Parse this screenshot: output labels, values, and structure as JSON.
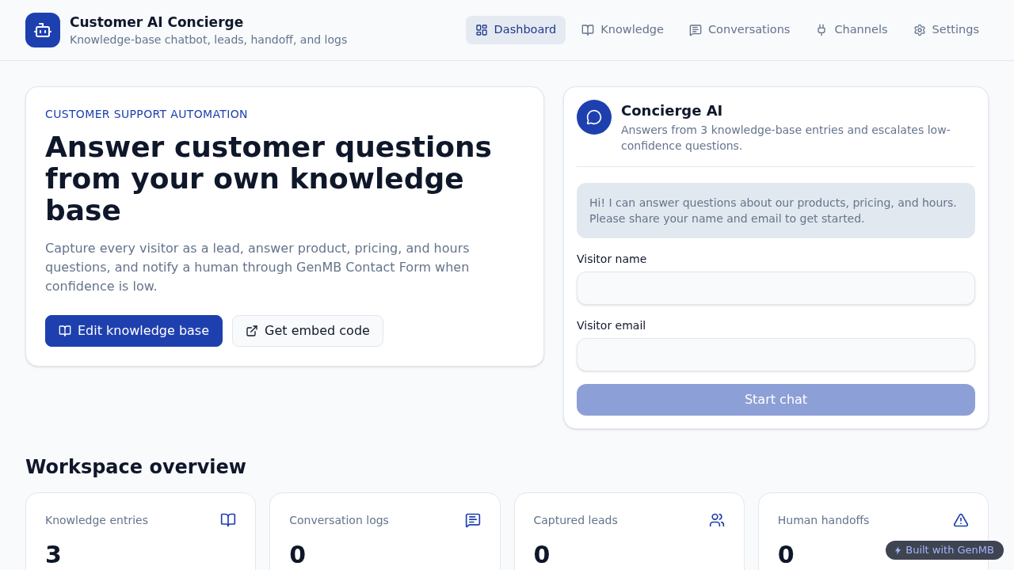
{
  "header": {
    "title": "Customer AI Concierge",
    "subtitle": "Knowledge-base chatbot, leads, handoff, and logs"
  },
  "nav": [
    {
      "label": "Dashboard",
      "selected": true
    },
    {
      "label": "Knowledge",
      "selected": false
    },
    {
      "label": "Conversations",
      "selected": false
    },
    {
      "label": "Channels",
      "selected": false
    },
    {
      "label": "Settings",
      "selected": false
    }
  ],
  "hero": {
    "eyebrow": "CUSTOMER SUPPORT AUTOMATION",
    "headline": "Answer customer questions from your own knowledge base",
    "body": "Capture every visitor as a lead, answer product, pricing, and hours questions, and notify a human through GenMB Contact Form when confidence is low.",
    "buttons": [
      {
        "label": "Edit knowledge base",
        "kind": "primary"
      },
      {
        "label": "Get embed code",
        "kind": "secondary"
      }
    ]
  },
  "chat": {
    "title": "Concierge AI",
    "description": "Answers from 3 knowledge-base entries and escalates low-confidence questions.",
    "message": "Hi! I can answer questions about our products, pricing, and hours. Please share your name and email to get started.",
    "fields": [
      {
        "label": "Visitor name"
      },
      {
        "label": "Visitor email"
      }
    ],
    "submit": {
      "label": "Start chat",
      "disabled": true
    }
  },
  "overview": {
    "title": "Workspace overview",
    "stats": [
      {
        "label": "Knowledge entries",
        "value": "3"
      },
      {
        "label": "Conversation logs",
        "value": "0"
      },
      {
        "label": "Captured leads",
        "value": "0"
      },
      {
        "label": "Human handoffs",
        "value": "0"
      }
    ]
  },
  "badge": {
    "label": "Built with GenMB"
  }
}
